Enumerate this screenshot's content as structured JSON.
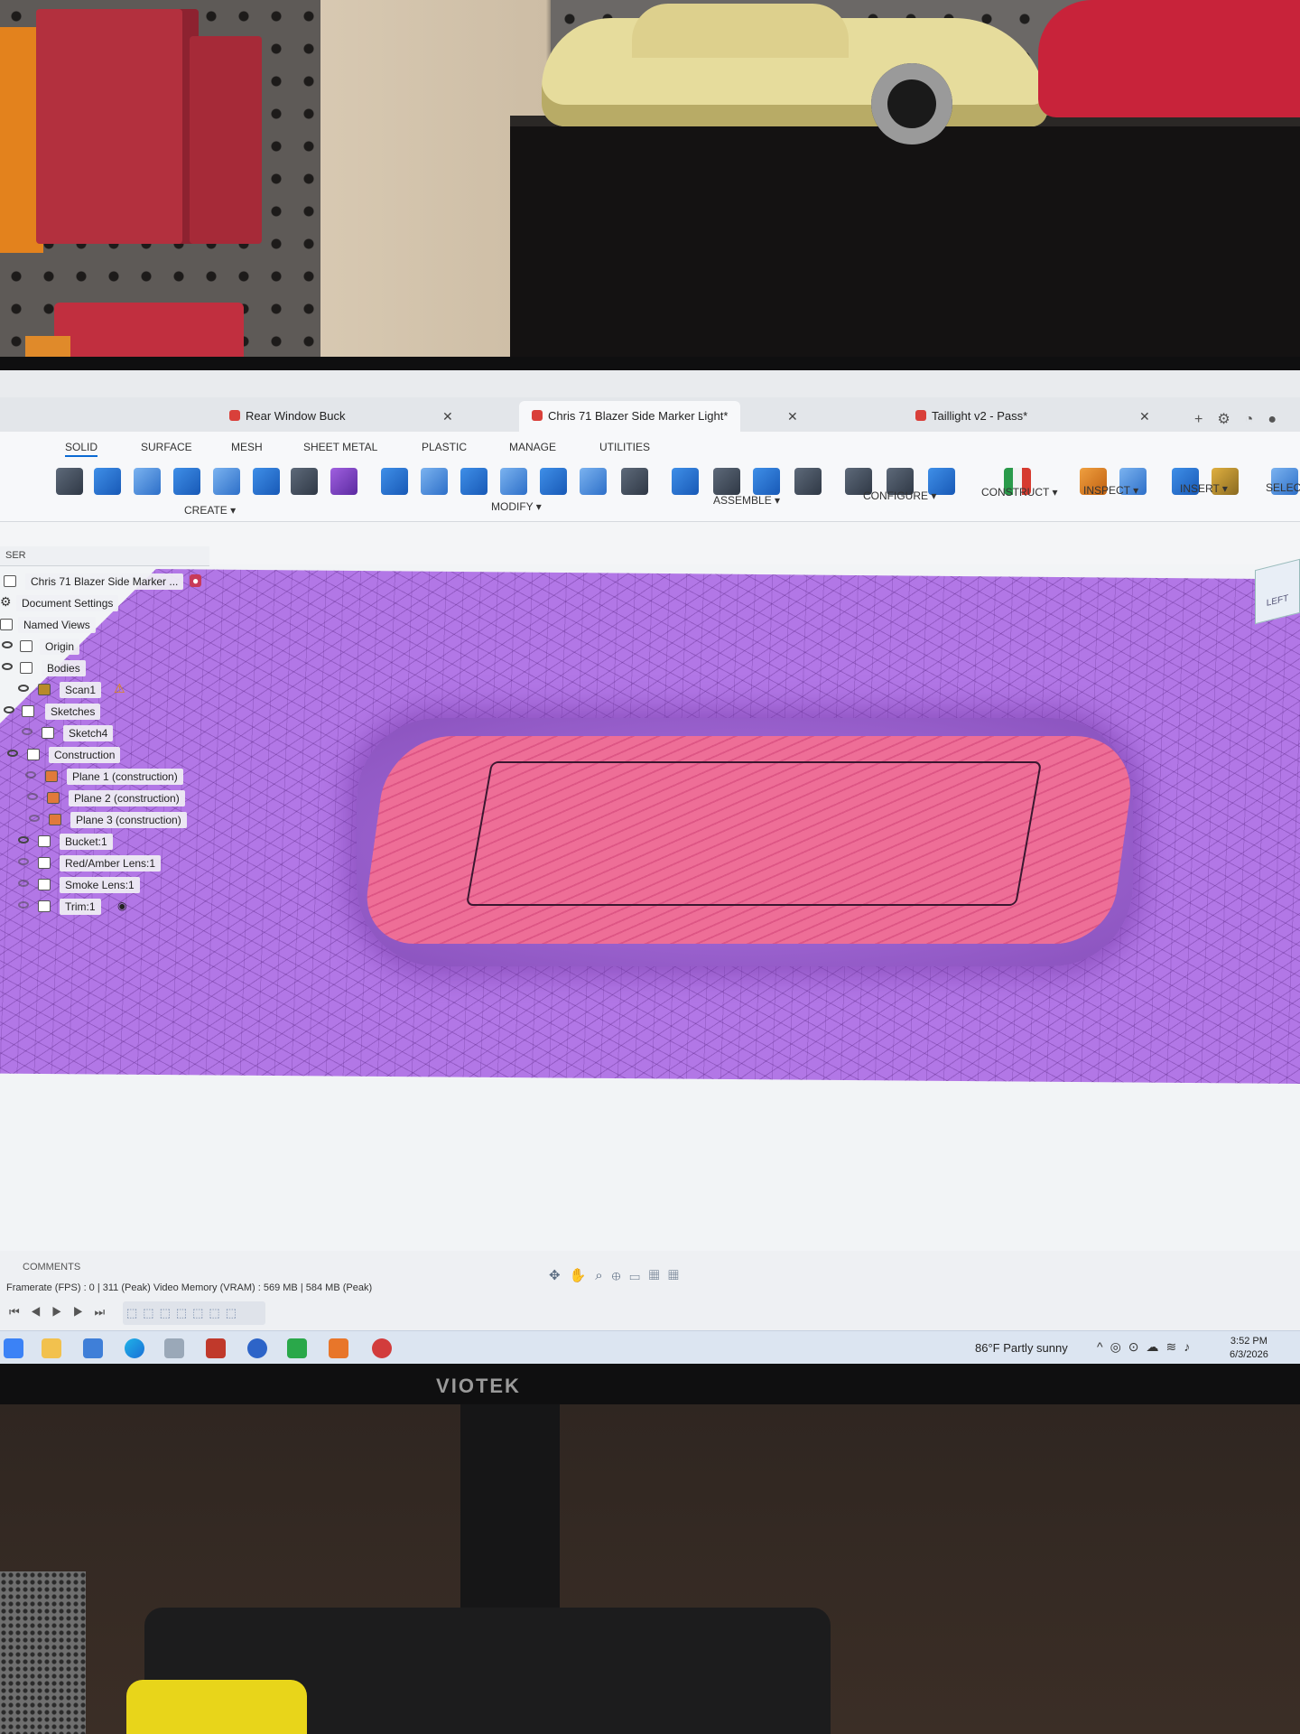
{
  "window": {
    "tabs": [
      {
        "label": "Rear Window Buck"
      },
      {
        "label": "Chris 71 Blazer Side Marker Light*"
      },
      {
        "label": "Taillight v2 - Pass*"
      }
    ]
  },
  "ribbon": {
    "tabs": [
      "SOLID",
      "SURFACE",
      "MESH",
      "SHEET METAL",
      "PLASTIC",
      "MANAGE",
      "UTILITIES"
    ],
    "groups": {
      "create": "CREATE ▾",
      "modify": "MODIFY ▾",
      "assemble": "ASSEMBLE ▾",
      "configure": "CONFIGURE ▾",
      "construct": "CONSTRUCT ▾",
      "inspect": "INSPECT ▾",
      "insert": "INSERT ▾",
      "select": "SELEC"
    }
  },
  "browser": {
    "header": "SER",
    "root": "Chris 71 Blazer Side Marker ...",
    "items": [
      {
        "label": "Document Settings"
      },
      {
        "label": "Named Views"
      },
      {
        "label": "Origin"
      },
      {
        "label": "Bodies"
      },
      {
        "label": "Scan1"
      },
      {
        "label": "Sketches"
      },
      {
        "label": "Sketch4"
      },
      {
        "label": "Construction"
      },
      {
        "label": "Plane 1 (construction)"
      },
      {
        "label": "Plane 2 (construction)"
      },
      {
        "label": "Plane 3 (construction)"
      },
      {
        "label": "Bucket:1"
      },
      {
        "label": "Red/Amber Lens:1"
      },
      {
        "label": "Smoke Lens:1"
      },
      {
        "label": "Trim:1"
      }
    ]
  },
  "viewcube": {
    "label": "LEFT"
  },
  "bottom": {
    "comments": "COMMENTS",
    "fps": "Framerate (FPS) : 0 | 311 (Peak) Video Memory (VRAM) : 569 MB | 584 MB (Peak)"
  },
  "taskbar": {
    "weather": "86°F  Partly sunny",
    "time": "3:52 PM",
    "date": "6/3/2026"
  },
  "monitor": {
    "brand": "VIOTEK"
  },
  "colors": {
    "mesh": "#b277e6",
    "lens": "#ee6e97",
    "accent": "#0a6ad4"
  }
}
